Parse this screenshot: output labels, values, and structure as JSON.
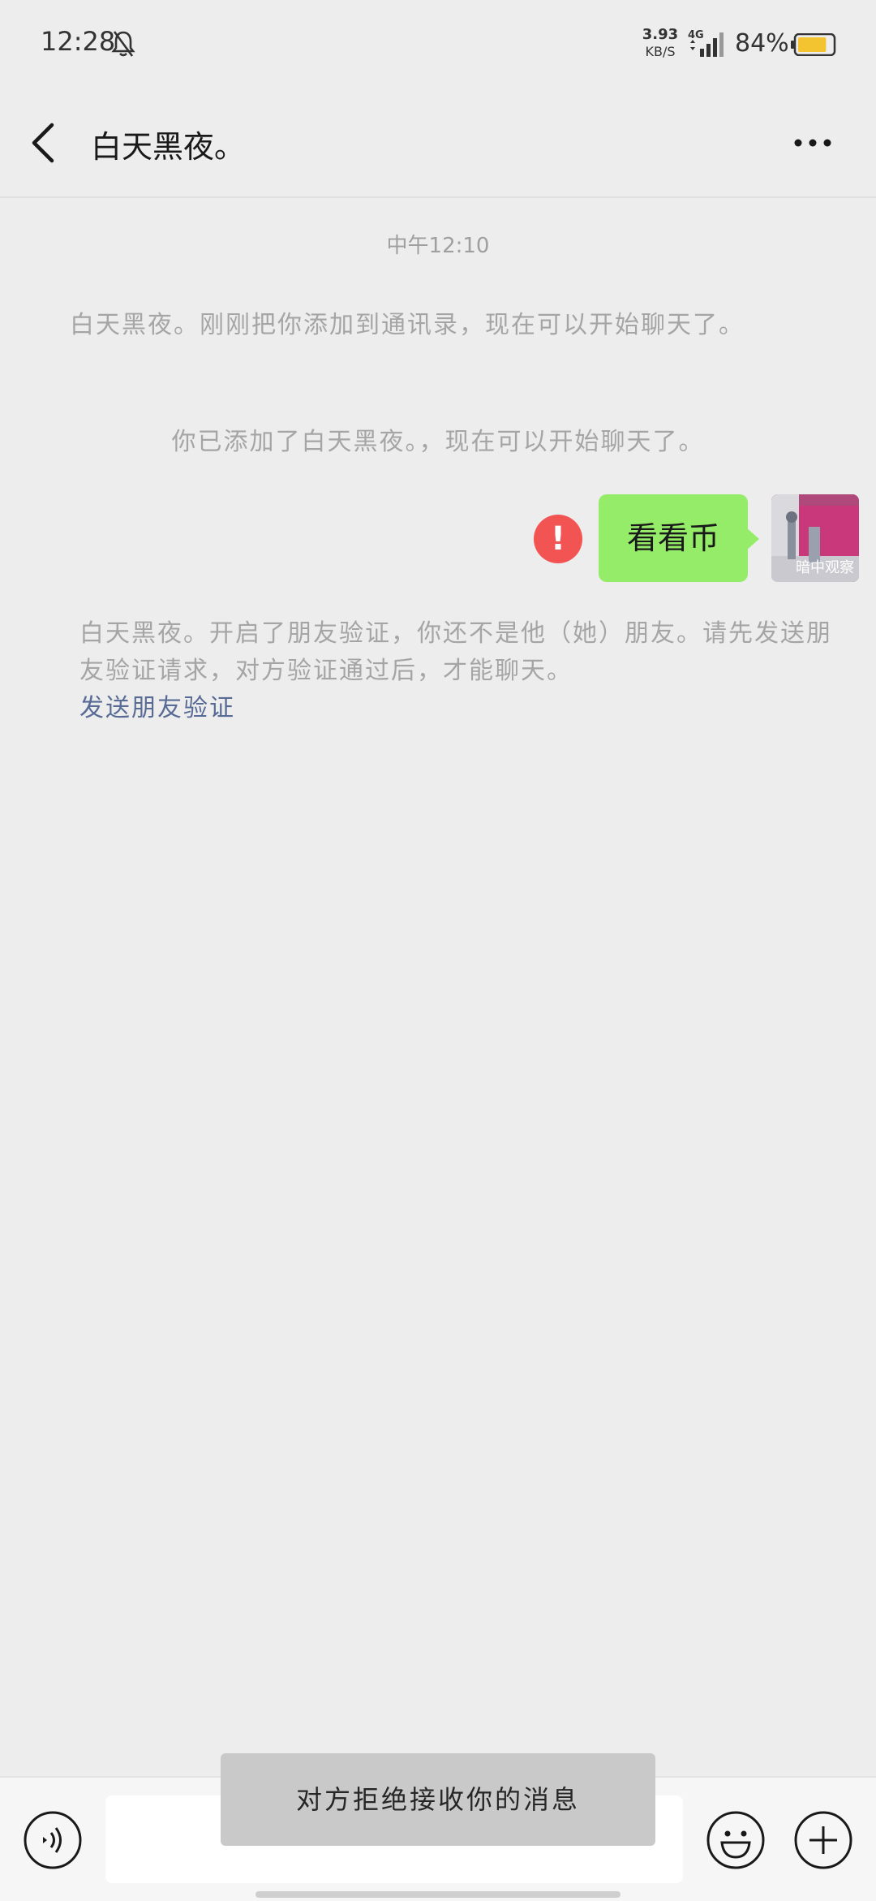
{
  "status_bar": {
    "time": "12:28",
    "net_speed_value": "3.93",
    "net_speed_unit": "KB/S",
    "network_type": "4G",
    "battery_percent": "84%",
    "battery_level": 0.84,
    "icons": [
      "bell-off-icon",
      "signal-icon",
      "battery-icon"
    ]
  },
  "header": {
    "title": "白天黑夜。",
    "icons": [
      "back-arrow-icon",
      "more-icon"
    ]
  },
  "chat": {
    "timestamp": "中午12:10",
    "system_message_1": "白天黑夜。刚刚把你添加到通讯录，现在可以开始聊天了。",
    "system_message_2": "你已添加了白天黑夜。，现在可以开始聊天了。",
    "sent_message": "看看币",
    "error_mark": "!",
    "avatar_caption": "暗中观察",
    "verification_notice": "白天黑夜。开启了朋友验证，你还不是他（她）朋友。请先发送朋友验证请求，对方验证通过后，才能聊天。",
    "verification_link": "发送朋友验证"
  },
  "toast": {
    "text": "对方拒绝接收你的消息"
  },
  "input_bar": {
    "input_value": "",
    "icons": [
      "voice-icon",
      "emoji-icon",
      "plus-icon"
    ]
  },
  "colors": {
    "background": "#ededed",
    "bubble_green": "#95ec69",
    "error_red": "#f25353",
    "link_blue": "#576b95"
  }
}
